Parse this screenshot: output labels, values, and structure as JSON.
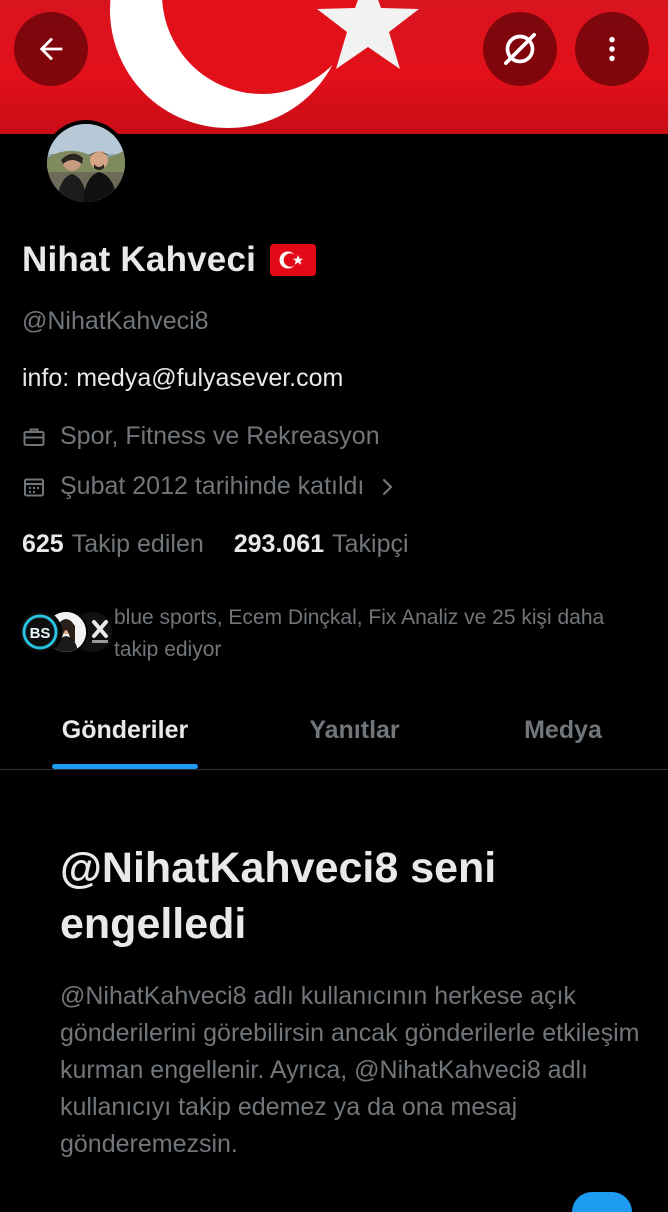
{
  "colors": {
    "banner_red": "#e30a17",
    "accent_blue": "#1d9bf0",
    "text_primary": "#e7e9ea",
    "text_secondary": "#71767b",
    "divider": "#2f3336"
  },
  "header": {
    "back_icon": "arrow-left-icon",
    "hide_icon": "eye-slash-icon",
    "more_icon": "more-vertical-icon"
  },
  "profile": {
    "name": "Nihat Kahveci",
    "name_emoji": "turkey-flag",
    "handle": "@NihatKahveci8",
    "bio": "info: medya@fulyasever.com",
    "category": "Spor, Fitness ve Rekreasyon",
    "joined": "Şubat 2012 tarihinde katıldı",
    "following_count": "625",
    "following_label": "Takip edilen",
    "followers_count": "293.061",
    "followers_label": "Takipçi",
    "followed_by": "blue sports, Ecem Dinçkal, Fix Analiz ve 25 kişi daha takip ediyor"
  },
  "tabs": [
    {
      "label": "Gönderiler",
      "active": true
    },
    {
      "label": "Yanıtlar",
      "active": false
    },
    {
      "label": "Medya",
      "active": false
    }
  ],
  "blocked": {
    "title": "@NihatKahveci8 seni engelledi",
    "body": "@NihatKahveci8 adlı kullanıcının herkese açık gönderilerini görebilirsin ancak gönderilerle etkileşim kurman engellenir. Ayrıca, @NihatKahveci8 adlı kullanıcıyı takip edemez ya da ona mesaj gönderemezsin."
  }
}
